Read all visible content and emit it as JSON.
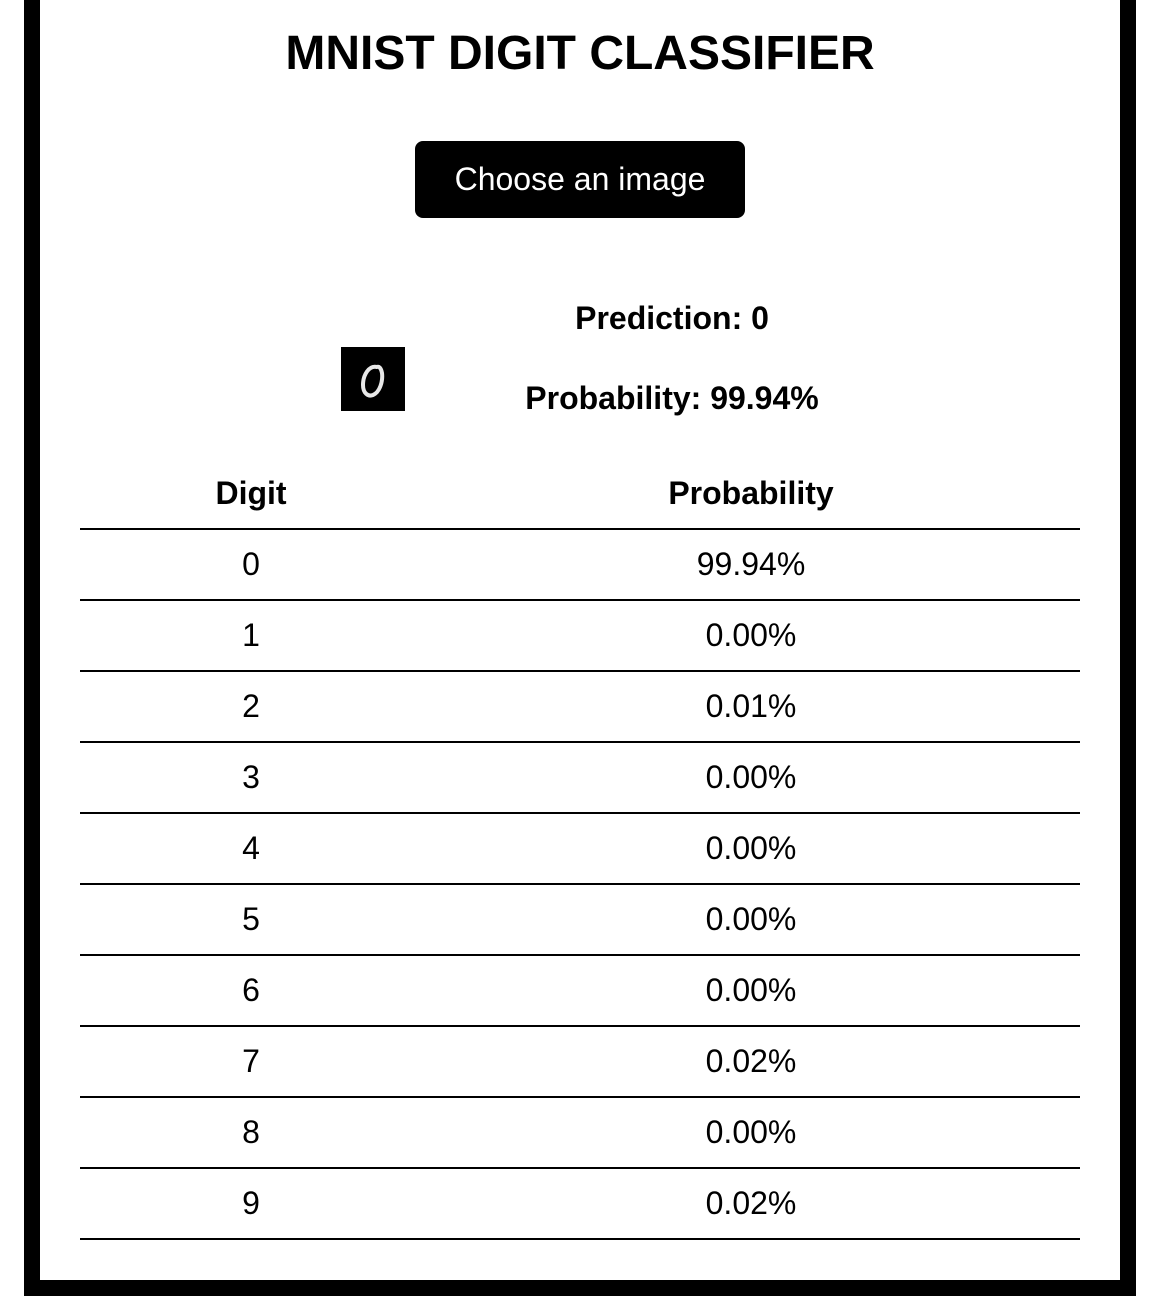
{
  "page": {
    "title": "MNIST DIGIT CLASSIFIER"
  },
  "upload": {
    "button_label": "Choose an image"
  },
  "result": {
    "prediction_text": "Prediction: 0",
    "probability_text": "Probability: 99.94%",
    "thumbnail_digit": "0"
  },
  "table": {
    "headers": [
      "Digit",
      "Probability"
    ],
    "rows": [
      {
        "digit": "0",
        "probability": "99.94%"
      },
      {
        "digit": "1",
        "probability": "0.00%"
      },
      {
        "digit": "2",
        "probability": "0.01%"
      },
      {
        "digit": "3",
        "probability": "0.00%"
      },
      {
        "digit": "4",
        "probability": "0.00%"
      },
      {
        "digit": "5",
        "probability": "0.00%"
      },
      {
        "digit": "6",
        "probability": "0.00%"
      },
      {
        "digit": "7",
        "probability": "0.02%"
      },
      {
        "digit": "8",
        "probability": "0.00%"
      },
      {
        "digit": "9",
        "probability": "0.02%"
      }
    ]
  },
  "colors": {
    "frame": "#000000",
    "background": "#ffffff",
    "button_bg": "#000000",
    "button_text": "#ffffff"
  }
}
